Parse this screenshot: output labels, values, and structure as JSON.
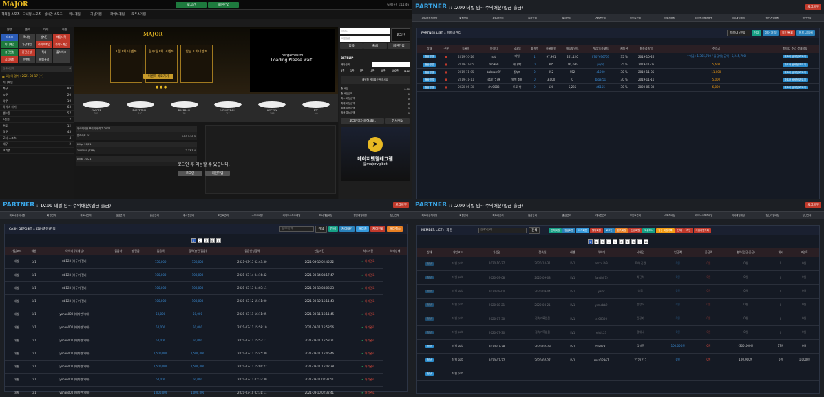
{
  "casino": {
    "logo": "MAJOR",
    "top_buttons": [
      "로그인",
      "회원가입"
    ],
    "clock": "GMT+9 1:11:46",
    "gnav": [
      "해외형 스포츠",
      "국내형 스포츠",
      "실시간 스포츠",
      "미니게임",
      "가상게임",
      "라이브게임",
      "로투스게임"
    ],
    "sidebar_top": [
      "일반",
      "종목",
      "마이",
      "회원"
    ],
    "sidebar_grid": [
      {
        "t": "스포츠",
        "c": "#2b5cb8"
      },
      {
        "t": "국내형",
        "c": "#3a3a3a"
      },
      {
        "t": "실시간",
        "c": "#3a3a3a"
      },
      {
        "t": "배팅내역",
        "c": "#c0392b"
      },
      {
        "t": "미니게임",
        "c": "#1e7a3e"
      },
      {
        "t": "가상게임",
        "c": "#3a3a3a"
      },
      {
        "t": "라이브게임",
        "c": "#c0392b"
      },
      {
        "t": "카지노게임",
        "c": "#c0392b"
      },
      {
        "t": "충전신청",
        "c": "#1e7a3e"
      },
      {
        "t": "환전신청",
        "c": "#c0392b"
      },
      {
        "t": "쪽지",
        "c": "#3a3a3a"
      },
      {
        "t": "출석체크",
        "c": "#3a3a3a"
      },
      {
        "t": "공지사항",
        "c": "#c0392b"
      },
      {
        "t": "이벤트",
        "c": "#3a3a3a"
      },
      {
        "t": "배팅규정",
        "c": "#3a3a3a"
      },
      {
        "t": "",
        "c": "#3a3a3a"
      }
    ],
    "search_placeholder": "검색어입력",
    "today": "오늘의 경기 : 2021-03-17 (수)",
    "sports_list": [
      {
        "n": "미니게임",
        "v": ""
      },
      {
        "n": "축구",
        "v": "88"
      },
      {
        "n": "농구",
        "v": "20"
      },
      {
        "n": "야구",
        "v": "16"
      },
      {
        "n": "아이스 하키",
        "v": "63"
      },
      {
        "n": "핸드볼",
        "v": "57"
      },
      {
        "n": "e풋볼",
        "v": "2"
      },
      {
        "n": "권투",
        "v": "12"
      },
      {
        "n": "탁구",
        "v": "45"
      },
      {
        "n": "모터 스포츠",
        "v": "4"
      },
      {
        "n": "배구",
        "v": "2"
      },
      {
        "n": "크리켓",
        "v": ""
      }
    ],
    "events": [
      "1일1회 이벤트",
      "일주일1회 이벤트",
      "한달 1회이벤트"
    ],
    "event_button": "이벤트 바로가기",
    "video_brand": "betgames.tv",
    "video_text": "Loading Please wait.",
    "sports_tabs": [
      {
        "n": "SOCCER",
        "v": "365"
      },
      {
        "n": "BASKETBALL",
        "v": "102"
      },
      {
        "n": "BASEBALL",
        "v": "14"
      },
      {
        "n": "VOLLEYBALL",
        "v": "27"
      },
      {
        "n": "HOCKEY",
        "v": "198"
      },
      {
        "n": "ETC",
        "v": "+0"
      }
    ],
    "login_prompt": "로그인 후 이용할 수 있습니다.",
    "login_btns": [
      "로그인",
      "회원가입"
    ],
    "matches": [
      {
        "league": "아르메니안 프리미어 리그 20/21",
        "team": "알라라트 FC",
        "score": "2.33  3.50  3"
      },
      {
        "league": "Liliga 20/21",
        "team": "TAFFARA (TSR)",
        "score": "2.33  3.4"
      },
      {
        "league": "Liliga 20/21",
        "team": "",
        "score": ""
      }
    ],
    "right_inputs": [
      "아이디",
      "비밀번호"
    ],
    "right_btn": "로그인",
    "right_tabs": [
      "입금",
      "출금",
      "회원가입"
    ],
    "betslip": "BETSLIP",
    "bet_label": "배당금액",
    "bet_chips": [
      "5천",
      "1만",
      "5만",
      "10만",
      "50만",
      "100만",
      "MAX"
    ],
    "bet_note": "배팅할 게임을 선택하세요",
    "bet_rows": [
      {
        "k": "총 배당",
        "v": "0.00"
      },
      {
        "k": "총 배당금액",
        "v": "0"
      },
      {
        "k": "최소 배팅금액",
        "v": "0"
      },
      {
        "k": "최대 배팅금액",
        "v": "0"
      },
      {
        "k": "최대 당첨금액",
        "v": "0"
      },
      {
        "k": "적중 예상금액",
        "v": "0"
      }
    ],
    "bet_btns": [
      "로그인후이용하세요.",
      "전체취소"
    ],
    "tele_text": "메이저벳텔레그램",
    "tele_id": "@majorvipbet"
  },
  "pq2": {
    "title1": "PARTNER",
    "title2": ":: LV.99 데빌 님~ 수익배분(입금-출금)",
    "logout": "로그아웃",
    "tabs": [
      "파트너공지사항",
      "회원관리",
      "파트너관리",
      "입금관리",
      "출금관리",
      "게시판관리",
      "포인트관리",
      "스포츠배팅",
      "라이브스포츠배팅",
      "미니게임배팅",
      "정산게임배팅",
      "정산관리"
    ],
    "panel_title": "PARTNER LIST :: 파트너관리",
    "select": "파트너 선택",
    "actions": [
      "검색",
      "정산일정",
      "할인율표",
      "파트너등록"
    ],
    "headers": [
      "상태",
      "구분",
      "등록일",
      "아이디",
      "닉네임",
      "회원수",
      "하위회원",
      "배팅포인트",
      "가입/추종코드",
      "커미션",
      "최종접속일",
      "수익금",
      "파트너 수익 상세정보"
    ],
    "rows": [
      {
        "d": "2019-10-26",
        "id": "patl",
        "nick": "데빌",
        "m": "1",
        "sub": "97,961",
        "pt": "261,120",
        "code": "0707676767",
        "c": "35 %",
        "last": "2019-10-26",
        "profit": "수익금 : 1,365,700 / 출금가능금액 : 5,245,700"
      },
      {
        "d": "2019-11-05",
        "id": "mb969",
        "nick": "헤나/박",
        "m": "0",
        "sub": "305",
        "pt": "16,396",
        "code": "pqqq",
        "c": "35 %",
        "last": "2019-11-05",
        "profit": "5,600"
      },
      {
        "d": "2019-11-05",
        "id": "babsarn9f",
        "nick": "중부파",
        "m": "0",
        "sub": "052",
        "pt": "952",
        "code": "c1000",
        "c": "30 %",
        "last": "2019-11-05",
        "profit": "11,000"
      },
      {
        "d": "2019-11-11",
        "id": "star7579",
        "nick": "왕벨 조회",
        "m": "0",
        "sub": "3,000",
        "pt": "0",
        "code": "bigar51",
        "c": "30 %",
        "last": "2019-11-11",
        "profit": "5,000"
      },
      {
        "d": "2020-06-30",
        "id": "shr0083",
        "nick": "토토 박",
        "m": "0",
        "sub": "120",
        "pt": "5,235",
        "code": "d6155",
        "c": "30 %",
        "last": "2020-06-30",
        "profit": "6,000"
      }
    ],
    "state": "정상영업",
    "detail": "파트너 상세정보 보기"
  },
  "pq3": {
    "title1": "PARTNER",
    "title2": ":: LV.99 데빌 님~ 수익배분(입금-출금)",
    "logout": "로그아웃",
    "panel_title": "CASH DEPOSIT :: 입금(충전)관리",
    "search_placeholder": "검색어입력",
    "search_btn": "검색",
    "filter_btns": [
      {
        "t": "전체",
        "c": "#16a085"
      },
      {
        "t": "처리대기",
        "c": "#2980b9"
      },
      {
        "t": "처리중",
        "c": "#3498db"
      },
      {
        "t": "처리완료",
        "c": "#c0392b"
      },
      {
        "t": "처리취소",
        "c": "#e67e22"
      }
    ],
    "pages": [
      "1",
      "2",
      "3",
      "4",
      "5"
    ],
    "headers": [
      "가입코드",
      "레벨",
      "아이디 (닉네임)",
      "입금자",
      "충전금",
      "입금액",
      "금액(충전/입금)",
      "입금신청금액",
      "신청시간",
      "처리시간",
      "처리상태"
    ],
    "rows": [
      {
        "lv": "LV1",
        "id": "rtb123 (바두기/진기)",
        "a": "150,000",
        "at": "2021-03-15 02:43:30",
        "pt": "2021-03-15 02:45:22"
      },
      {
        "lv": "LV1",
        "id": "rtb123 (바두기/진기)",
        "a": "100,000",
        "at": "2021-03-14 04:16:42",
        "pt": "2021-03-14 04:17:47"
      },
      {
        "lv": "LV1",
        "id": "rtb123 (바두기/진기)",
        "a": "100,000",
        "at": "2021-03-13 04:03:11",
        "pt": "2021-03-13 04:03:23"
      },
      {
        "lv": "LV1",
        "id": "rtb123 (바두기/진기)",
        "a": "100,000",
        "at": "2021-03-12 15:11:00",
        "pt": "2021-03-12 15:11:43"
      },
      {
        "lv": "LV1",
        "id": "yohan000 (네자연/시대)",
        "a": "50,000",
        "at": "2021-03-11 16:11:05",
        "pt": "2021-03-11 16:11:45"
      },
      {
        "lv": "LV1",
        "id": "yohan000 (네자연/시대)",
        "a": "50,000",
        "at": "2021-03-11 15:58:10",
        "pt": "2021-03-11 15:58:56"
      },
      {
        "lv": "LV1",
        "id": "yohan000 (네자연/시대)",
        "a": "50,000",
        "at": "2021-03-11 15:53:11",
        "pt": "2021-03-11 15:53:21"
      },
      {
        "lv": "LV1",
        "id": "yohan000 (네자연/시대)",
        "a": "1,500,000",
        "at": "2021-03-11 15:45:30",
        "pt": "2021-03-11 15:46:46"
      },
      {
        "lv": "LV1",
        "id": "yohan000 (네자연/시대)",
        "a": "1,500,000",
        "at": "2021-03-11 15:01:22",
        "pt": "2021-03-11 15:02:38"
      },
      {
        "lv": "LV1",
        "id": "yohan000 (네자연/시대)",
        "a": "60,000",
        "at": "2021-03-11 02:37:30",
        "pt": "2021-03-11 02:37:51"
      },
      {
        "lv": "LV1",
        "id": "yohan000 (네자연/시대)",
        "a": "1,000,000",
        "at": "2021-03-10 02:31:11",
        "pt": "2021-03-10 02:32:41"
      }
    ],
    "code": "데빌",
    "status": "처리완료"
  },
  "pq4": {
    "title1": "PARTNER",
    "title2": ":: LV.99 데빌 님~ 수익배분(입금-출금)",
    "logout": "로그아웃",
    "panel_title": "MEMBER LIST :: 회원",
    "search_placeholder": "검색어입력",
    "search_btn": "검색",
    "filter_btns": [
      {
        "t": "전체회원",
        "c": "#16a085"
      },
      {
        "t": "정상회원",
        "c": "#2980b9"
      },
      {
        "t": "대기회원",
        "c": "#3498db"
      },
      {
        "t": "탈퇴회원",
        "c": "#c0392b"
      },
      {
        "t": "로그인",
        "c": "#2980b9"
      },
      {
        "t": "접속회원",
        "c": "#e67e22"
      },
      {
        "t": "신규회원",
        "c": "#c0392b"
      },
      {
        "t": "보유머니",
        "c": "#16a085"
      },
      {
        "t": "정산 회원목록",
        "c": "#f39c12"
      },
      {
        "t": "전체",
        "c": "#c0392b"
      },
      {
        "t": "차단",
        "c": "#c0392b"
      },
      {
        "t": "가입회원목록",
        "c": "#c0392b"
      }
    ],
    "pages": [
      "1",
      "2",
      "3",
      "4",
      "5",
      "6",
      "7",
      "8",
      "9",
      "10"
    ],
    "headers": [
      "상태",
      "가입코드",
      "가입일",
      "접속일",
      "레벨",
      "아이디",
      "닉네임",
      "입금액",
      "출금액",
      "손익(입금-출금)",
      "게시",
      "포인트"
    ],
    "rows": [
      {
        "code": "데빌 patl",
        "j": "2020-10-27",
        "l": "2020-10-31",
        "lv": "LV1",
        "id": "reccc.ih9",
        "n": "토여 김경",
        "i": "0원",
        "o": "0원",
        "p": "0원",
        "g": "0",
        "pt": "0원"
      },
      {
        "code": "데빌 patl",
        "j": "2020-09-08",
        "l": "2020-09-08",
        "lv": "LV1",
        "id": "fandhi(1)",
        "n": "최진희",
        "i": "0원",
        "o": "0원",
        "p": "0원",
        "g": "0",
        "pt": "0원"
      },
      {
        "code": "데빌 patl",
        "j": "2020-09-04",
        "l": "2020-09-04",
        "lv": "LV1",
        "id": "yaior",
        "n": "상품",
        "i": "0원",
        "o": "0원",
        "p": "0원",
        "g": "0",
        "pt": "0원"
      },
      {
        "code": "데빌 patl",
        "j": "2020-08-21",
        "l": "2020-08-21",
        "lv": "LV1",
        "id": "yrmobb9",
        "n": "방랑어",
        "i": "0원",
        "o": "0원",
        "p": "0원",
        "g": "0",
        "pt": "0원"
      },
      {
        "code": "데빌 patl",
        "j": "2020-07-30",
        "l": "접속기록없음",
        "lv": "LV1",
        "id": "er00300",
        "n": "김정자",
        "i": "0원",
        "o": "0원",
        "p": "0원",
        "g": "0",
        "pt": "0원"
      },
      {
        "code": "데빌 patl",
        "j": "2020-07-30",
        "l": "접속기록없음",
        "lv": "LV1",
        "id": "ehd123",
        "n": "정대나",
        "i": "0원",
        "o": "0원",
        "p": "0원",
        "g": "0",
        "pt": "0원"
      },
      {
        "code": "데빌 patl",
        "j": "2020-07-28",
        "l": "2020-07-29",
        "lv": "LV1",
        "id": "tak0731",
        "n": "김영준",
        "i": "100,000원",
        "o": "0원",
        "p": "-300,000원",
        "g": "17원",
        "pt": "0원"
      },
      {
        "code": "데빌 patl",
        "j": "2020-07-27",
        "l": "2020-07-27",
        "lv": "LV1",
        "id": "sosa12367",
        "n": "7171717",
        "i": "0원",
        "o": "0원",
        "p": "100,000원",
        "g": "0원",
        "pt": "1,000원"
      },
      {
        "code": "데빌 patl",
        "j": "",
        "l": "",
        "lv": "",
        "id": "",
        "n": "",
        "i": "",
        "o": "",
        "p": "",
        "g": "",
        "pt": ""
      }
    ]
  }
}
